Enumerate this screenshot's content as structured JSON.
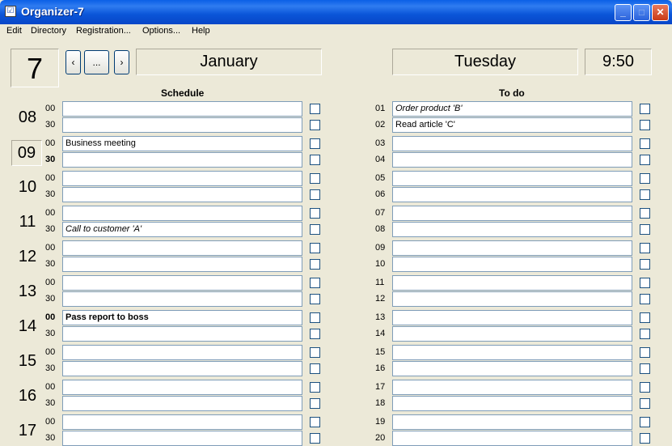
{
  "window": {
    "title": "Organizer-7",
    "app_icon": "checklist-icon"
  },
  "menu": [
    "Edit",
    "Directory",
    "Registration...",
    "Options...",
    "Help"
  ],
  "nav": {
    "prev_label": "‹",
    "more_label": "...",
    "next_label": "›"
  },
  "date": {
    "day": "7",
    "month": "January",
    "weekday": "Tuesday",
    "time": "9:50"
  },
  "schedule": {
    "header": "Schedule",
    "hours": [
      {
        "hour": "08",
        "active": false,
        "slots": [
          {
            "min": "00",
            "text": ""
          },
          {
            "min": "30",
            "text": ""
          }
        ]
      },
      {
        "hour": "09",
        "active": true,
        "slots": [
          {
            "min": "00",
            "text": "Business meeting"
          },
          {
            "min": "30",
            "text": "",
            "bold": true
          }
        ]
      },
      {
        "hour": "10",
        "active": false,
        "slots": [
          {
            "min": "00",
            "text": ""
          },
          {
            "min": "30",
            "text": ""
          }
        ]
      },
      {
        "hour": "11",
        "active": false,
        "slots": [
          {
            "min": "00",
            "text": ""
          },
          {
            "min": "30",
            "text": "Call to customer 'A'",
            "italic": true
          }
        ]
      },
      {
        "hour": "12",
        "active": false,
        "slots": [
          {
            "min": "00",
            "text": ""
          },
          {
            "min": "30",
            "text": ""
          }
        ]
      },
      {
        "hour": "13",
        "active": false,
        "slots": [
          {
            "min": "00",
            "text": ""
          },
          {
            "min": "30",
            "text": ""
          }
        ]
      },
      {
        "hour": "14",
        "active": false,
        "slots": [
          {
            "min": "00",
            "text": "Pass report to boss",
            "bold": true
          },
          {
            "min": "30",
            "text": ""
          }
        ]
      },
      {
        "hour": "15",
        "active": false,
        "slots": [
          {
            "min": "00",
            "text": ""
          },
          {
            "min": "30",
            "text": ""
          }
        ]
      },
      {
        "hour": "16",
        "active": false,
        "slots": [
          {
            "min": "00",
            "text": ""
          },
          {
            "min": "30",
            "text": ""
          }
        ]
      },
      {
        "hour": "17",
        "active": false,
        "slots": [
          {
            "min": "00",
            "text": ""
          },
          {
            "min": "30",
            "text": ""
          }
        ]
      }
    ]
  },
  "todo": {
    "header": "To do",
    "items": [
      {
        "num": "01",
        "text": "Order product 'B'",
        "italic": true
      },
      {
        "num": "02",
        "text": "Read article 'C'"
      },
      {
        "num": "03",
        "text": ""
      },
      {
        "num": "04",
        "text": ""
      },
      {
        "num": "05",
        "text": ""
      },
      {
        "num": "06",
        "text": ""
      },
      {
        "num": "07",
        "text": ""
      },
      {
        "num": "08",
        "text": ""
      },
      {
        "num": "09",
        "text": ""
      },
      {
        "num": "10",
        "text": ""
      },
      {
        "num": "11",
        "text": ""
      },
      {
        "num": "12",
        "text": ""
      },
      {
        "num": "13",
        "text": ""
      },
      {
        "num": "14",
        "text": ""
      },
      {
        "num": "15",
        "text": ""
      },
      {
        "num": "16",
        "text": ""
      },
      {
        "num": "17",
        "text": ""
      },
      {
        "num": "18",
        "text": ""
      },
      {
        "num": "19",
        "text": ""
      },
      {
        "num": "20",
        "text": ""
      }
    ]
  }
}
